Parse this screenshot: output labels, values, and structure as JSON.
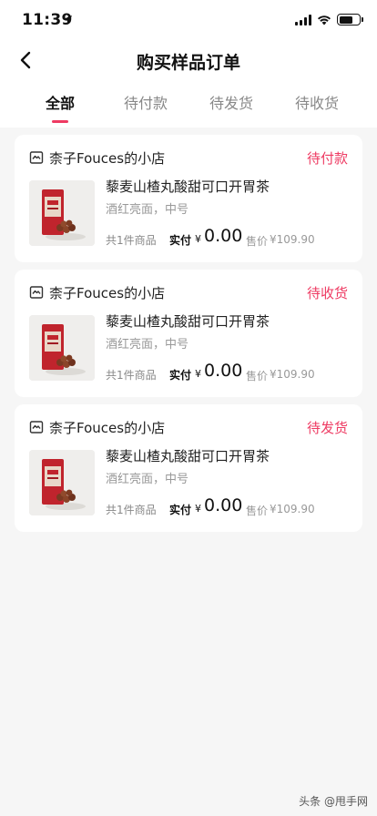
{
  "status_bar": {
    "time": "11:39",
    "location_icon": "location-arrow-icon",
    "signal_icon": "cellular-signal-icon",
    "wifi_icon": "wifi-icon",
    "battery_icon": "battery-icon"
  },
  "nav": {
    "back_icon": "chevron-left-icon",
    "title": "购买样品订单"
  },
  "tabs": [
    {
      "label": "全部",
      "active": true
    },
    {
      "label": "待付款",
      "active": false
    },
    {
      "label": "待发货",
      "active": false
    },
    {
      "label": "待收货",
      "active": false
    }
  ],
  "orders": [
    {
      "shop_icon": "shop-icon",
      "shop_name": "柰子Fouces的小店",
      "status": "待付款",
      "product_name": "藜麦山楂丸酸甜可口开胃茶",
      "spec": "酒红亮面，中号",
      "count": "共1件商品",
      "pay_label": "实付",
      "currency": "¥",
      "pay_amount": "0.00",
      "sale_label": "售价",
      "sale_price": "¥109.90"
    },
    {
      "shop_icon": "shop-icon",
      "shop_name": "柰子Fouces的小店",
      "status": "待收货",
      "product_name": "藜麦山楂丸酸甜可口开胃茶",
      "spec": "酒红亮面，中号",
      "count": "共1件商品",
      "pay_label": "实付",
      "currency": "¥",
      "pay_amount": "0.00",
      "sale_label": "售价",
      "sale_price": "¥109.90"
    },
    {
      "shop_icon": "shop-icon",
      "shop_name": "柰子Fouces的小店",
      "status": "待发货",
      "product_name": "藜麦山楂丸酸甜可口开胃茶",
      "spec": "酒红亮面，中号",
      "count": "共1件商品",
      "pay_label": "实付",
      "currency": "¥",
      "pay_amount": "0.00",
      "sale_label": "售价",
      "sale_price": "¥109.90"
    }
  ],
  "colors": {
    "accent": "#ee3a62",
    "background": "#f6f6f6",
    "card": "#ffffff"
  },
  "watermark": "头条 @甩手网"
}
